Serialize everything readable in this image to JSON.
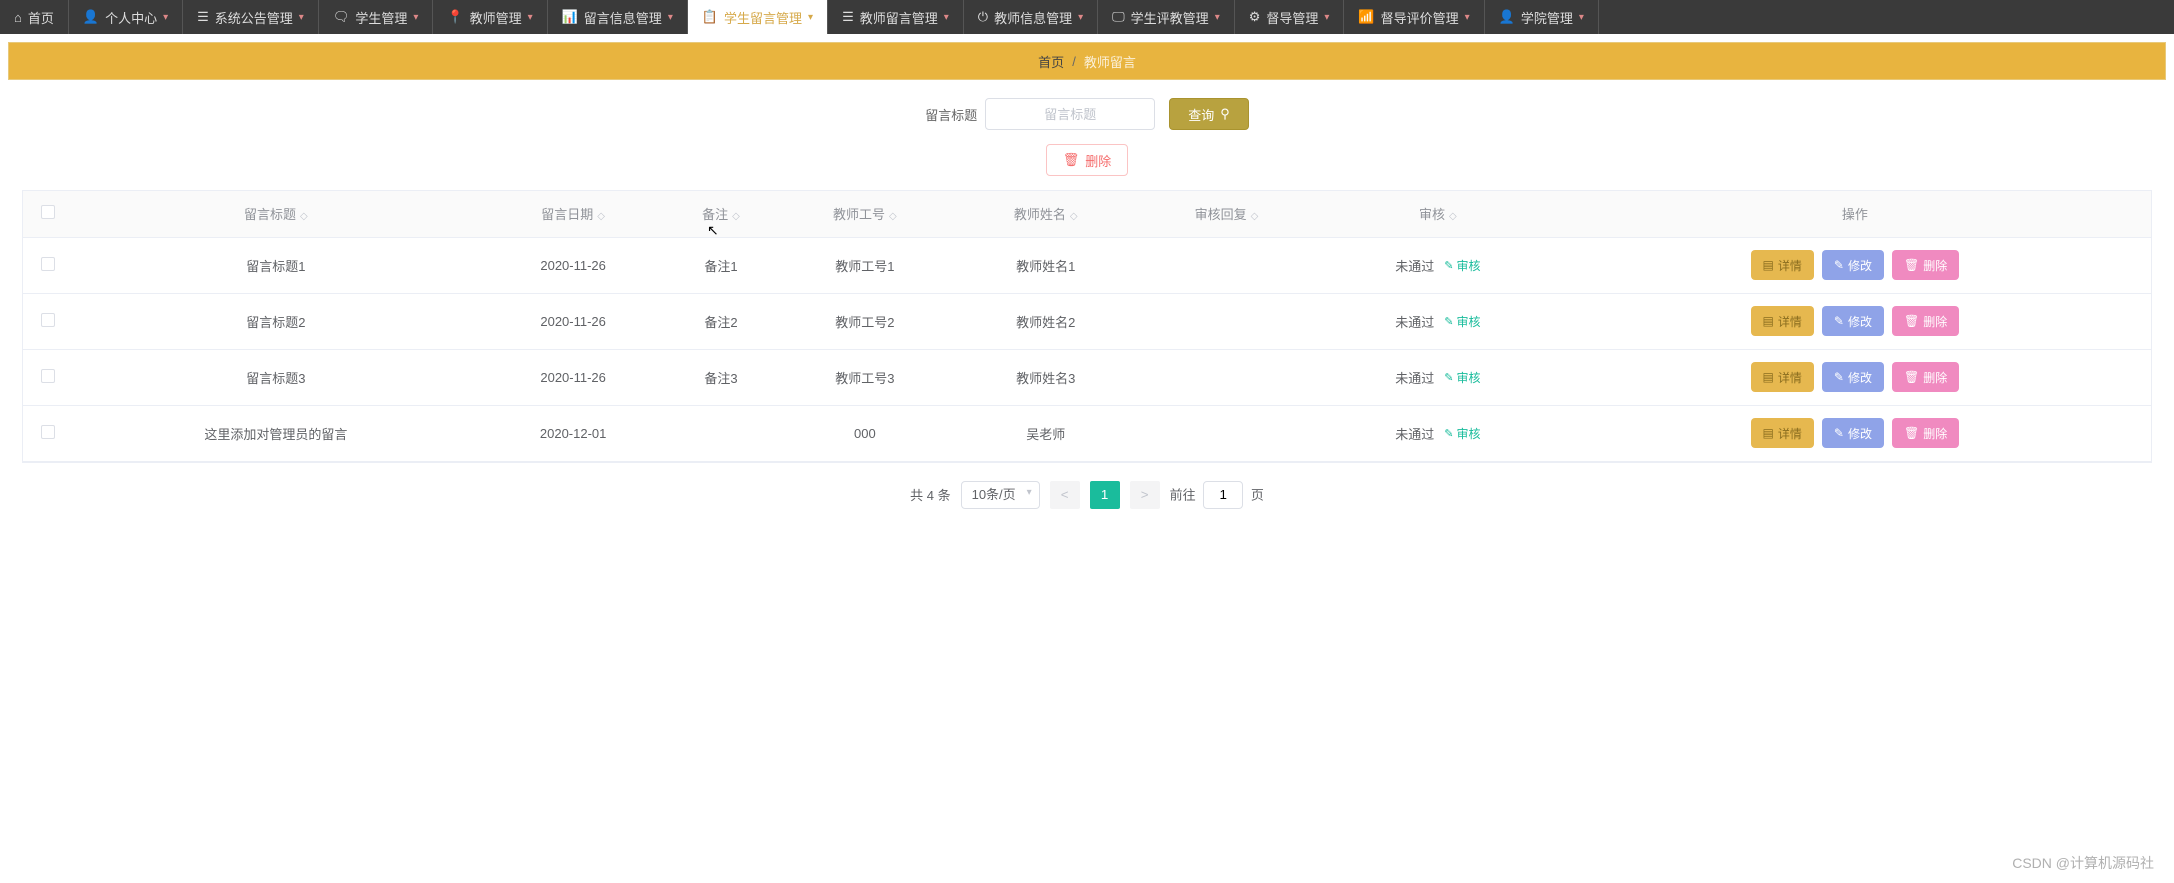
{
  "nav": [
    {
      "label": "首页",
      "icon": "⌂"
    },
    {
      "label": "个人中心",
      "icon": "👤"
    },
    {
      "label": "系统公告管理",
      "icon": "☰"
    },
    {
      "label": "学生管理",
      "icon": "🗨"
    },
    {
      "label": "教师管理",
      "icon": "📍"
    },
    {
      "label": "留言信息管理",
      "icon": "📊"
    },
    {
      "label": "学生留言管理",
      "icon": "📋",
      "active": true
    },
    {
      "label": "教师留言管理",
      "icon": "☰"
    },
    {
      "label": "教师信息管理",
      "icon": "⏻"
    },
    {
      "label": "学生评教管理",
      "icon": "🖵"
    },
    {
      "label": "督导管理",
      "icon": "⚙"
    },
    {
      "label": "督导评价管理",
      "icon": "📶"
    },
    {
      "label": "学院管理",
      "icon": "👤"
    }
  ],
  "breadcrumb": {
    "home": "首页",
    "sep": "/",
    "current": "教师留言"
  },
  "search": {
    "label": "留言标题",
    "placeholder": "留言标题",
    "query_btn": "查询"
  },
  "toolbar": {
    "delete_btn": "删除"
  },
  "table": {
    "headers": [
      "留言标题",
      "留言日期",
      "备注",
      "教师工号",
      "教师姓名",
      "审核回复",
      "审核",
      "操作"
    ],
    "rows": [
      {
        "title": "留言标题1",
        "date": "2020-11-26",
        "note": "备注1",
        "tid": "教师工号1",
        "tname": "教师姓名1",
        "reply": "",
        "status": "未通过"
      },
      {
        "title": "留言标题2",
        "date": "2020-11-26",
        "note": "备注2",
        "tid": "教师工号2",
        "tname": "教师姓名2",
        "reply": "",
        "status": "未通过"
      },
      {
        "title": "留言标题3",
        "date": "2020-11-26",
        "note": "备注3",
        "tid": "教师工号3",
        "tname": "教师姓名3",
        "reply": "",
        "status": "未通过"
      },
      {
        "title": "这里添加对管理员的留言",
        "date": "2020-12-01",
        "note": "",
        "tid": "000",
        "tname": "吴老师",
        "reply": "",
        "status": "未通过"
      }
    ],
    "audit_link": "审核",
    "ops": {
      "detail": "详情",
      "edit": "修改",
      "del": "删除"
    }
  },
  "pager": {
    "total": "共 4 条",
    "page_size": "10条/页",
    "current": "1",
    "jump_prefix": "前往",
    "jump_value": "1",
    "jump_suffix": "页"
  },
  "watermark": "CSDN @计算机源码社"
}
